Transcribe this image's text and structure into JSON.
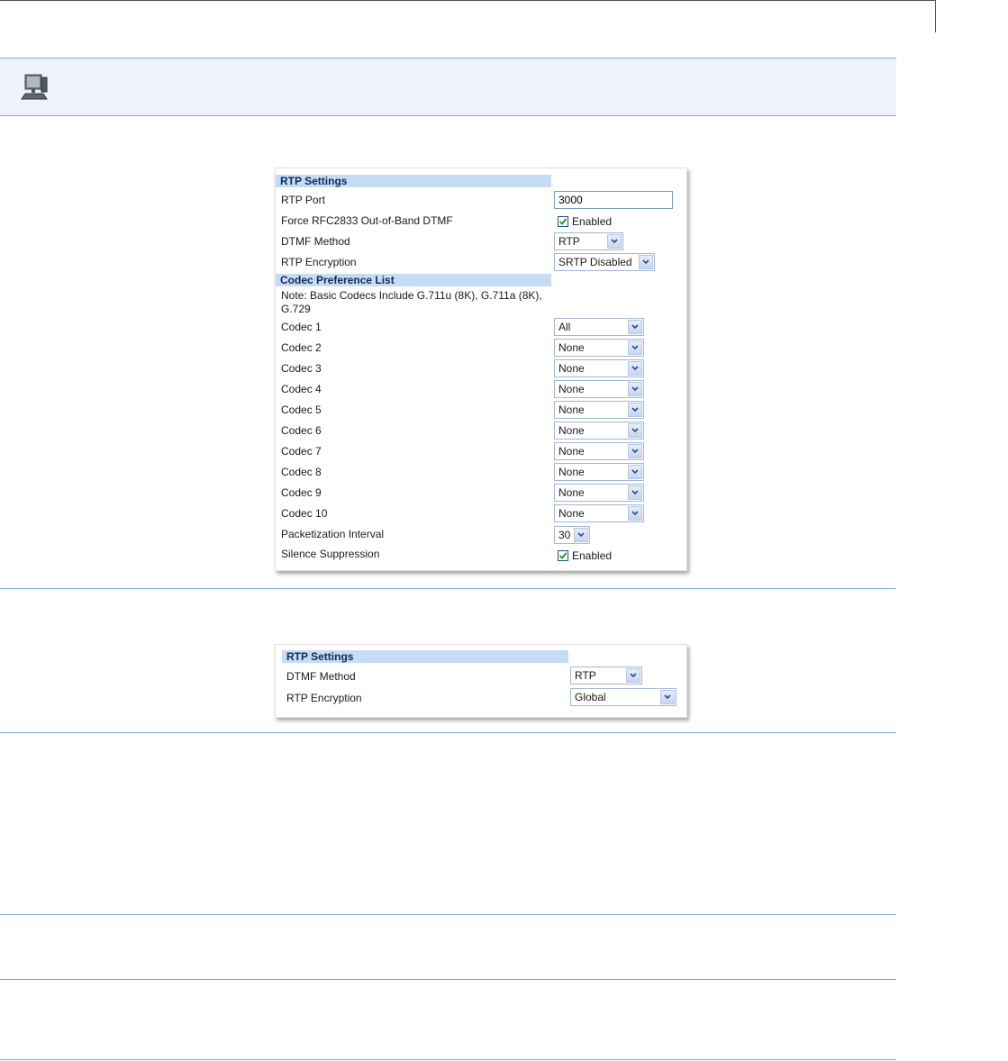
{
  "panel1": {
    "section_rtp": "RTP Settings",
    "rtp_port_label": "RTP Port",
    "rtp_port_value": "3000",
    "force_rfc_label": "Force RFC2833 Out-of-Band DTMF",
    "force_rfc_checked": true,
    "force_rfc_text": "Enabled",
    "dtmf_label": "DTMF Method",
    "dtmf_value": "RTP",
    "encryption_label": "RTP Encryption",
    "encryption_value": "SRTP Disabled",
    "section_codec": "Codec Preference List",
    "note": "Note: Basic Codecs Include G.711u (8K), G.711a (8K), G.729",
    "codecs": [
      {
        "label": "Codec 1",
        "value": "All"
      },
      {
        "label": "Codec 2",
        "value": "None"
      },
      {
        "label": "Codec 3",
        "value": "None"
      },
      {
        "label": "Codec 4",
        "value": "None"
      },
      {
        "label": "Codec 5",
        "value": "None"
      },
      {
        "label": "Codec 6",
        "value": "None"
      },
      {
        "label": "Codec 7",
        "value": "None"
      },
      {
        "label": "Codec 8",
        "value": "None"
      },
      {
        "label": "Codec 9",
        "value": "None"
      },
      {
        "label": "Codec 10",
        "value": "None"
      }
    ],
    "packet_label": "Packetization Interval",
    "packet_value": "30",
    "silence_label": "Silence Suppression",
    "silence_checked": true,
    "silence_text": "Enabled"
  },
  "panel2": {
    "section_rtp": "RTP Settings",
    "dtmf_label": "DTMF Method",
    "dtmf_value": "RTP",
    "encryption_label": "RTP Encryption",
    "encryption_value": "Global"
  },
  "colors": {
    "section_header_bg": "#c6dcf3",
    "section_header_text": "#0d2a5c",
    "rule": "#7fa9d6",
    "checkbox_check": "#2a8c2a"
  },
  "icons": {
    "header": "computer-icon",
    "checkbox": "checkmark-icon",
    "dropdown": "chevron-down-icon"
  }
}
